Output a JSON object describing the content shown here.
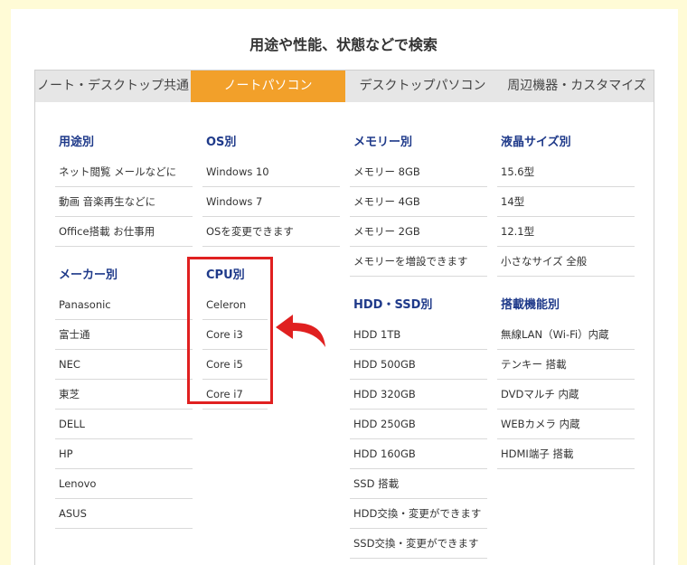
{
  "heading": "用途や性能、状態などで検索",
  "tabs": [
    {
      "label": "ノート・デスクトップ共通",
      "active": false
    },
    {
      "label": "ノートパソコン",
      "active": true
    },
    {
      "label": "デスクトップパソコン",
      "active": false
    },
    {
      "label": "周辺機器・カスタマイズ",
      "active": false
    }
  ],
  "columns": {
    "usage": {
      "title": "用途別",
      "items": [
        "ネット閲覧 メールなどに",
        "動画 音楽再生などに",
        "Office搭載 お仕事用"
      ]
    },
    "maker": {
      "title": "メーカー別",
      "items": [
        "Panasonic",
        "富士通",
        "NEC",
        "東芝",
        "DELL",
        "HP",
        "Lenovo",
        "ASUS"
      ]
    },
    "os": {
      "title": "OS別",
      "items": [
        "Windows 10",
        "Windows 7",
        "OSを変更できます"
      ]
    },
    "cpu": {
      "title": "CPU別",
      "items": [
        "Celeron",
        "Core i3",
        "Core i5",
        "Core i7"
      ]
    },
    "memory": {
      "title": "メモリー別",
      "items": [
        "メモリー 8GB",
        "メモリー 4GB",
        "メモリー 2GB",
        "メモリーを増設できます"
      ]
    },
    "storage": {
      "title": "HDD・SSD別",
      "items": [
        "HDD 1TB",
        "HDD 500GB",
        "HDD 320GB",
        "HDD 250GB",
        "HDD 160GB",
        "SSD 搭載",
        "HDD交換・変更ができます",
        "SSD交換・変更ができます"
      ]
    },
    "screen": {
      "title": "液晶サイズ別",
      "items": [
        "15.6型",
        "14型",
        "12.1型",
        "小さなサイズ 全般"
      ]
    },
    "features": {
      "title": "搭載機能別",
      "items": [
        "無線LAN（Wi-Fi）内蔵",
        "テンキー 搭載",
        "DVDマルチ 内蔵",
        "WEBカメラ 内蔵",
        "HDMI端子 搭載"
      ]
    }
  },
  "colors": {
    "background": "#fffbd6",
    "active_tab": "#f2a02a",
    "category_title": "#1f3a8a",
    "highlight": "#e02020"
  },
  "annotation_icon": "curved-arrow-icon"
}
